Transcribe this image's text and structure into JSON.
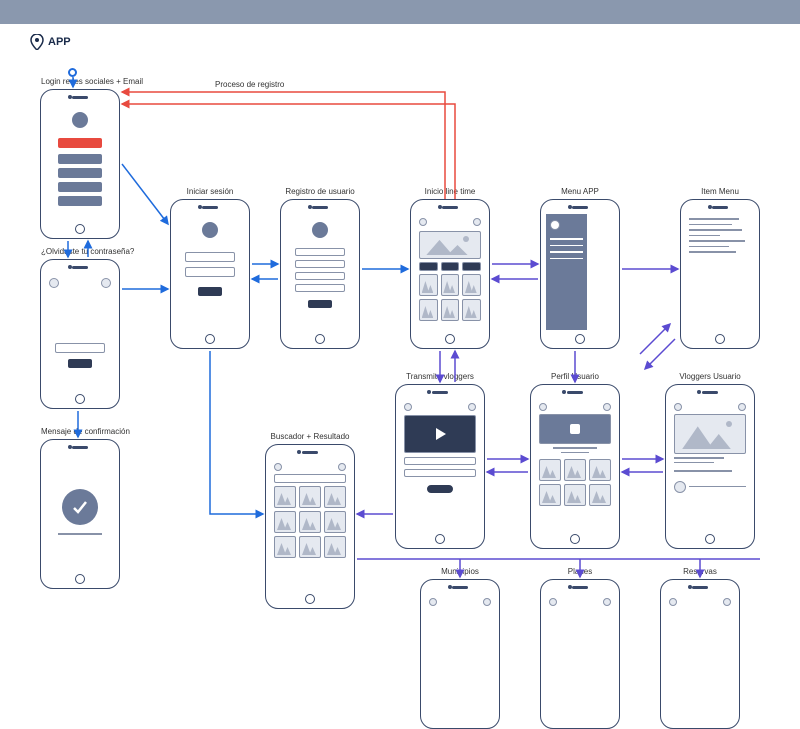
{
  "app_name": "APP",
  "flow_label_registro": "Proceso de registro",
  "screens": {
    "login_social": "Login redes sociales + Email",
    "forgot": "¿Olvidaste tu contraseña?",
    "signin": "Iniciar sesión",
    "signup": "Registro de usuario",
    "timeline": "Inicio line time",
    "menu": "Menu APP",
    "item_menu": "Item Menu",
    "confirm": "Mensaje de confirmación",
    "vlogger_stream": "Transmite vloggers",
    "profile": "Perfil Usuario",
    "vlogger_user": "Vloggers Usuario",
    "search": "Buscador + Resultado",
    "municipios": "Municipios",
    "planes": "Planes",
    "reservas": "Reservas"
  },
  "colors": {
    "stroke": "#3a4a6b",
    "blue": "#1f6bdc",
    "purple": "#5b4bd1",
    "red": "#e84a3f"
  }
}
